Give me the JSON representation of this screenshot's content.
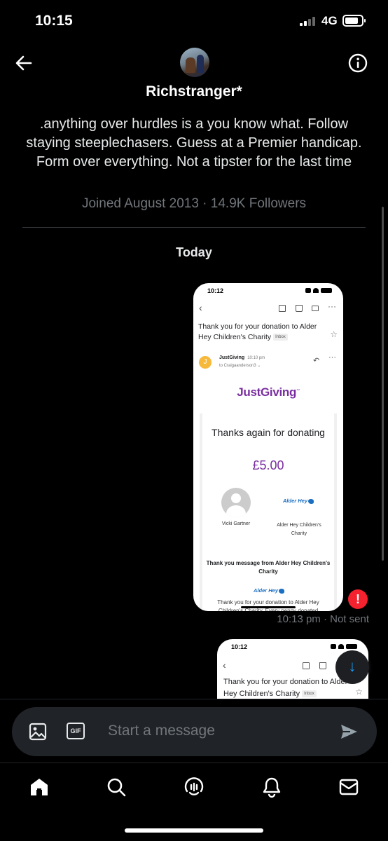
{
  "status_bar": {
    "time": "10:15",
    "network": "4G"
  },
  "header": {
    "name": "Richstranger*",
    "bio": ".anything over hurdles is a you know what. Follow staying steeplechasers. Guess at a Premier handicap. Form over everything. Not a tipster for the last time",
    "meta": "Joined August 2013 · 14.9K Followers"
  },
  "conversation": {
    "date_label": "Today",
    "message1": {
      "shot_time": "10:12",
      "subject": "Thank you for your donation to Alder Hey Children's Charity",
      "inbox_tag": "Inbox",
      "sender_initial": "J",
      "sender_name": "JustGiving",
      "sender_time": "10:10 pm",
      "sender_to": "to Craigaanderson3 ⌄",
      "brand": "JustGiving",
      "thanks_text": "Thanks again for donating",
      "amount": "£5.00",
      "donor_name": "Vicki Gartner",
      "charity_logo": "Alder Hey",
      "charity_name": "Alder Hey Children's Charity",
      "message_heading": "Thank you message from Alder Hey Children's Charity",
      "message_body": "Thank you for your donation to Alder Hey Children's Charity. Every penny donated",
      "error_symbol": "!",
      "status": "10:13 pm · Not sent"
    },
    "message2": {
      "shot_time": "10:12",
      "subject": "Thank you for your donation to Alder Hey Children's Charity",
      "inbox_tag": "Inbox"
    }
  },
  "composer": {
    "placeholder": "Start a message",
    "gif_label": "GIF"
  },
  "bottom_nav": [
    "home-icon",
    "search-icon",
    "spaces-icon",
    "notifications-icon",
    "messages-icon"
  ]
}
